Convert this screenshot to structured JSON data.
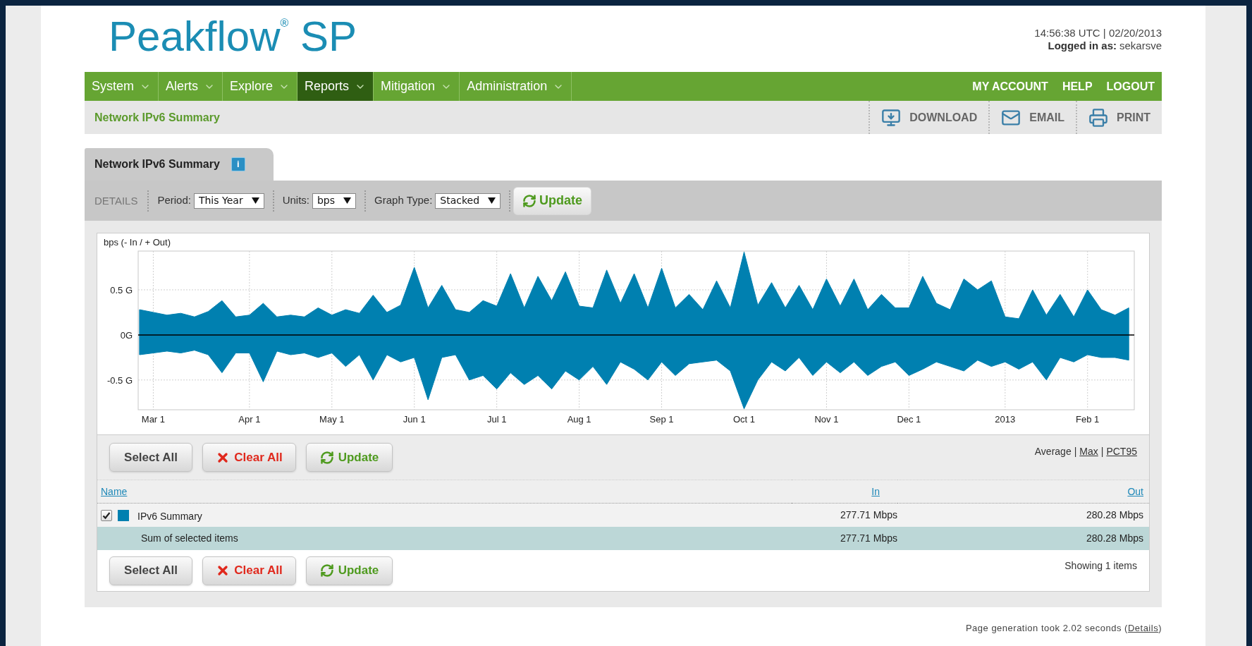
{
  "header": {
    "logo": "Peakflow$^{®}$ SP",
    "timestamp": "14:56:38 UTC | 02/20/2013",
    "login_label": "Logged in as:",
    "login_user": "sekarsve"
  },
  "nav": {
    "items": [
      {
        "label": "System",
        "selected": false
      },
      {
        "label": "Alerts",
        "selected": false
      },
      {
        "label": "Explore",
        "selected": false
      },
      {
        "label": "Reports",
        "selected": true
      },
      {
        "label": "Mitigation",
        "selected": false
      },
      {
        "label": "Administration",
        "selected": false
      }
    ],
    "links": [
      "MY ACCOUNT",
      "HELP",
      "LOGOUT"
    ]
  },
  "subbar": {
    "title": "Network IPv6 Summary",
    "actions": [
      {
        "label": "DOWNLOAD",
        "kind": "download"
      },
      {
        "label": "EMAIL",
        "kind": "email"
      },
      {
        "label": "PRINT",
        "kind": "print"
      }
    ]
  },
  "tab": {
    "label": "Network IPv6 Summary",
    "info": "i"
  },
  "details": {
    "label": "DETAILS",
    "filters": [
      {
        "label": "Period:",
        "value": "This Year"
      },
      {
        "label": "Units:",
        "value": "bps"
      },
      {
        "label": "Graph Type:",
        "value": "Stacked"
      }
    ],
    "update": "Update"
  },
  "chart_data": {
    "type": "area",
    "stacked": false,
    "grid": true,
    "ylabel": "bps (- In / + Out)",
    "ylim": [
      -0.83,
      0.93
    ],
    "yticks": [
      {
        "value": 0.5,
        "label": "0.5 G"
      },
      {
        "value": 0,
        "label": "0G"
      },
      {
        "value": -0.5,
        "label": "-0.5 G"
      }
    ],
    "categories": [
      null,
      "Mar 1",
      null,
      null,
      null,
      null,
      null,
      null,
      "Apr 1",
      null,
      null,
      null,
      null,
      null,
      "May 1",
      null,
      null,
      null,
      null,
      null,
      "Jun 1",
      null,
      null,
      null,
      null,
      null,
      "Jul 1",
      null,
      null,
      null,
      null,
      null,
      "Aug 1",
      null,
      null,
      null,
      null,
      null,
      "Sep 1",
      null,
      null,
      null,
      null,
      null,
      "Oct 1",
      null,
      null,
      null,
      null,
      null,
      "Nov 1",
      null,
      null,
      null,
      null,
      null,
      "Dec 1",
      null,
      null,
      null,
      null,
      null,
      null,
      "2013",
      null,
      null,
      null,
      null,
      null,
      "Feb 1",
      null,
      null,
      null
    ],
    "series": [
      {
        "color": "#0080b0",
        "values": [
          0.28,
          0.25,
          0.22,
          0.24,
          0.2,
          0.26,
          0.38,
          0.2,
          0.22,
          0.35,
          0.2,
          0.22,
          0.2,
          0.3,
          0.22,
          0.28,
          0.24,
          0.44,
          0.25,
          0.33,
          0.75,
          0.3,
          0.55,
          0.28,
          0.25,
          0.38,
          0.32,
          0.68,
          0.3,
          0.65,
          0.38,
          0.7,
          0.32,
          0.3,
          0.72,
          0.35,
          0.68,
          0.3,
          0.74,
          0.3,
          0.45,
          0.28,
          0.6,
          0.3,
          0.92,
          0.33,
          0.58,
          0.3,
          0.55,
          0.28,
          0.62,
          0.32,
          0.62,
          0.28,
          0.45,
          0.3,
          0.3,
          0.65,
          0.35,
          0.28,
          0.62,
          0.5,
          0.6,
          0.2,
          0.18,
          0.5,
          0.22,
          0.45,
          0.2,
          0.5,
          0.28,
          0.22,
          0.3
        ]
      },
      {
        "color": "#0080b0",
        "values": [
          -0.22,
          -0.2,
          -0.18,
          -0.2,
          -0.17,
          -0.22,
          -0.42,
          -0.2,
          -0.2,
          -0.52,
          -0.18,
          -0.22,
          -0.2,
          -0.25,
          -0.2,
          -0.35,
          -0.22,
          -0.5,
          -0.22,
          -0.3,
          -0.25,
          -0.72,
          -0.25,
          -0.22,
          -0.5,
          -0.45,
          -0.6,
          -0.42,
          -0.55,
          -0.45,
          -0.6,
          -0.4,
          -0.5,
          -0.35,
          -0.55,
          -0.3,
          -0.38,
          -0.5,
          -0.3,
          -0.45,
          -0.32,
          -0.3,
          -0.28,
          -0.4,
          -0.82,
          -0.5,
          -0.3,
          -0.4,
          -0.25,
          -0.45,
          -0.3,
          -0.42,
          -0.3,
          -0.45,
          -0.35,
          -0.3,
          -0.45,
          -0.38,
          -0.3,
          -0.35,
          -0.4,
          -0.28,
          -0.35,
          -0.3,
          -0.38,
          -0.3,
          -0.5,
          -0.25,
          -0.3,
          -0.22,
          -0.25,
          -0.25,
          -0.28
        ]
      }
    ]
  },
  "top_actions": {
    "buttons": [
      {
        "label": "Select All",
        "kind": "select"
      },
      {
        "label": "Clear All",
        "kind": "clear"
      },
      {
        "label": "Update",
        "kind": "update"
      }
    ],
    "stats": [
      {
        "label": "Average",
        "kind": "current"
      },
      {
        "label": "|",
        "kind": "separator"
      },
      {
        "label": "Max",
        "kind": "link"
      },
      {
        "label": "|",
        "kind": "separator"
      },
      {
        "label": "PCT95",
        "kind": "link"
      }
    ]
  },
  "table": {
    "columns": [
      "Name",
      "In",
      "Out"
    ],
    "rows": [
      {
        "checked": true,
        "color": "#0080b0",
        "name": "IPv6 Summary",
        "in": "277.71 Mbps",
        "out": "280.28 Mbps"
      }
    ],
    "summary": {
      "name": "Sum of selected items",
      "in": "277.71 Mbps",
      "out": "280.28 Mbps"
    }
  },
  "bottom_actions": {
    "buttons": [
      {
        "label": "Select All",
        "kind": "select"
      },
      {
        "label": "Clear All",
        "kind": "clear"
      },
      {
        "label": "Update",
        "kind": "update"
      }
    ],
    "count": "Showing 1 items"
  },
  "footer": {
    "before": "Page generation took 2.02 seconds (",
    "link": "Details",
    "after": ")"
  }
}
